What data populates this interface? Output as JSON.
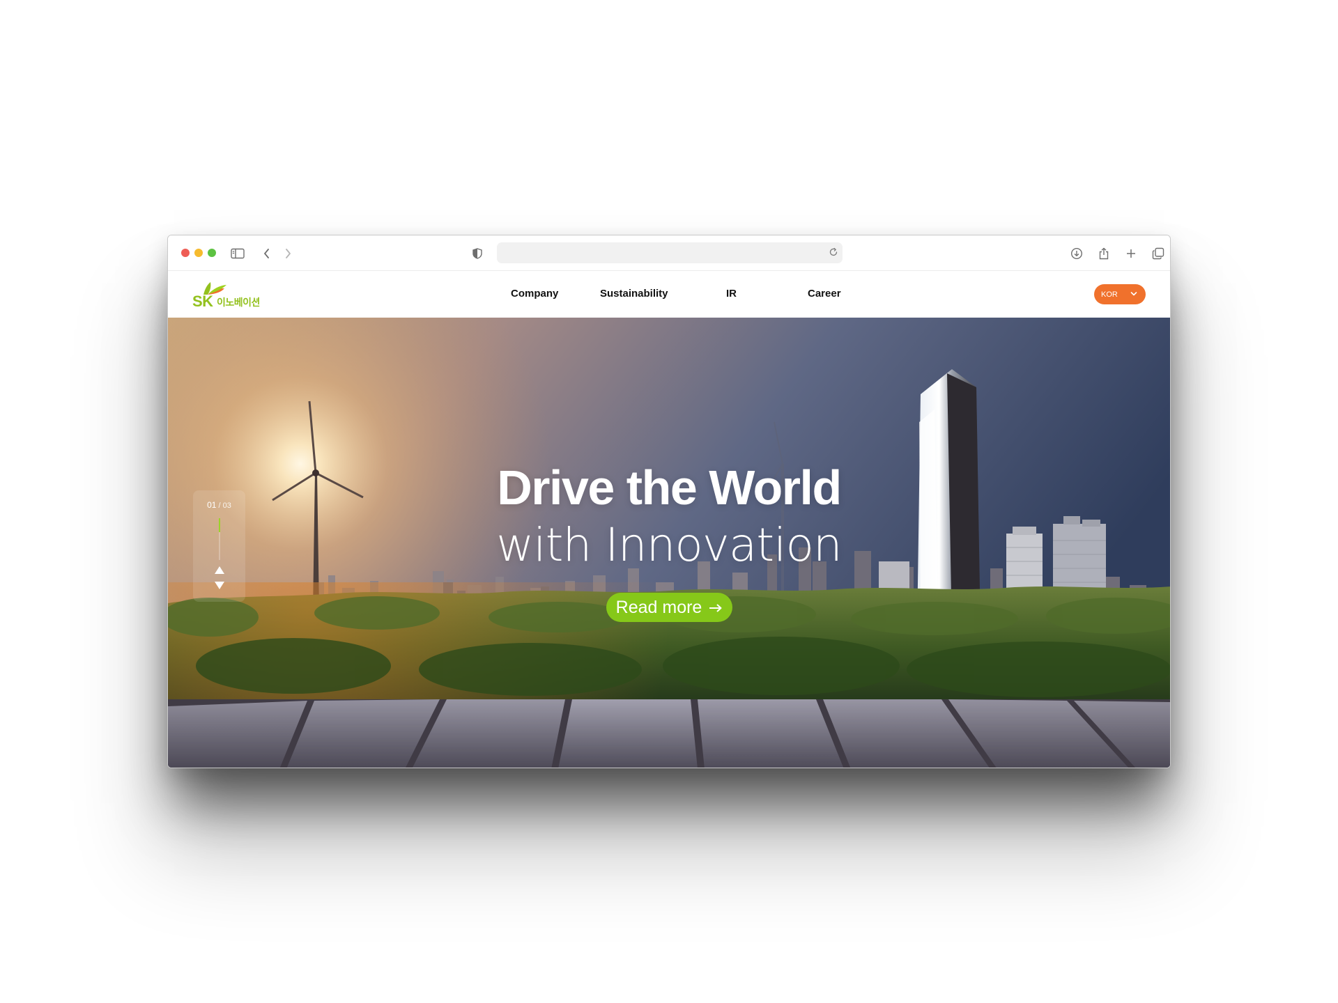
{
  "browser": {
    "address": ""
  },
  "header": {
    "logo": {
      "latin": "SK",
      "korean": "이노베이션"
    },
    "nav": [
      "Company",
      "Sustainability",
      "IR",
      "Career"
    ],
    "language": "KOR"
  },
  "hero": {
    "title_line1": "Drive the World",
    "title_line2": "with Innovation",
    "cta_label": "Read more",
    "slide": {
      "current": "01",
      "separator": " / ",
      "total": "03",
      "progress": 0.33
    }
  },
  "colors": {
    "brand_green": "#93c11e",
    "cta_green": "#86c819",
    "lang_orange": "#f0712c"
  },
  "icons": {
    "sidebar": "sidebar-icon",
    "back": "chevron-left-icon",
    "forward": "chevron-right-icon",
    "shield": "shield-icon",
    "reload": "reload-icon",
    "download": "download-icon",
    "share": "share-icon",
    "new_tab": "plus-icon",
    "tabs": "tabs-overview-icon",
    "cta_arrow": "arrow-right-icon",
    "slide_up": "triangle-up-icon",
    "slide_down": "triangle-down-icon",
    "lang_chevron": "chevron-down-icon"
  }
}
